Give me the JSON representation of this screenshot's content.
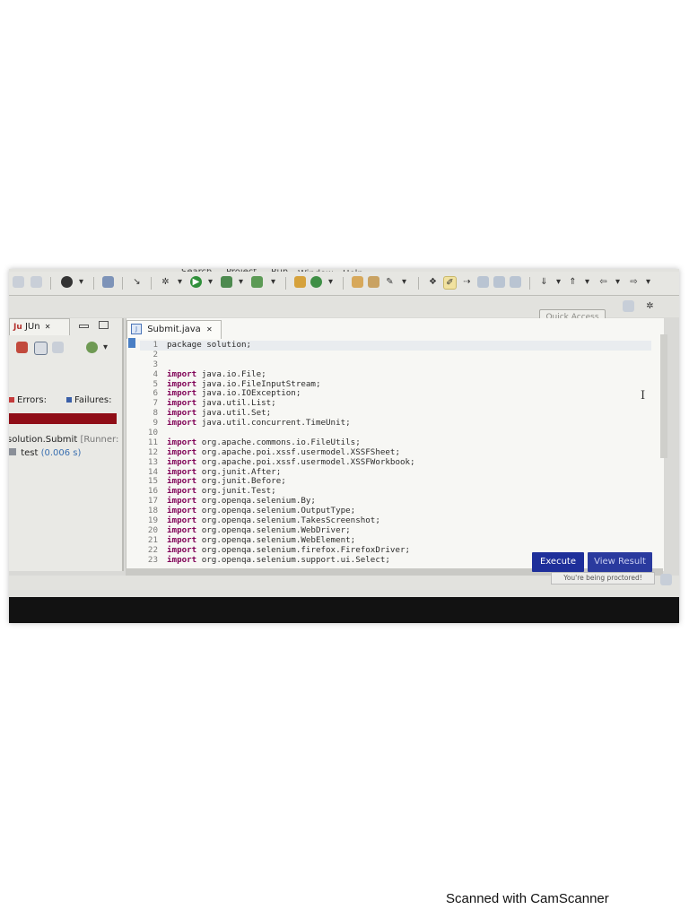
{
  "menubar": {
    "items": [
      "Search",
      "Project",
      "Run",
      "Window",
      "Help"
    ]
  },
  "quick_access": "Quick Access",
  "junit_panel": {
    "tab_label": "JUn",
    "errors_label": "Errors:",
    "failures_label": "Failures:",
    "suite": {
      "name": "solution.Submit",
      "runner": "[Runner:"
    },
    "test": {
      "name": "test",
      "time": "(0.006 s)"
    },
    "colors": {
      "failure_bar": "#8f0d16"
    }
  },
  "editor": {
    "tab_label": "Submit.java",
    "lines": [
      {
        "n": "1",
        "kw": "",
        "text": "package solution;"
      },
      {
        "n": "2",
        "kw": "",
        "text": ""
      },
      {
        "n": "3",
        "kw": "",
        "text": ""
      },
      {
        "n": "4",
        "kw": "import",
        "text": " java.io.File;"
      },
      {
        "n": "5",
        "kw": "import",
        "text": " java.io.FileInputStream;"
      },
      {
        "n": "6",
        "kw": "import",
        "text": " java.io.IOException;"
      },
      {
        "n": "7",
        "kw": "import",
        "text": " java.util.List;"
      },
      {
        "n": "8",
        "kw": "import",
        "text": " java.util.Set;"
      },
      {
        "n": "9",
        "kw": "import",
        "text": " java.util.concurrent.TimeUnit;"
      },
      {
        "n": "10",
        "kw": "",
        "text": ""
      },
      {
        "n": "11",
        "kw": "import",
        "text": " org.apache.commons.io.FileUtils;"
      },
      {
        "n": "12",
        "kw": "import",
        "text": " org.apache.poi.xssf.usermodel.XSSFSheet;"
      },
      {
        "n": "13",
        "kw": "import",
        "text": " org.apache.poi.xssf.usermodel.XSSFWorkbook;"
      },
      {
        "n": "14",
        "kw": "import",
        "text": " org.junit.After;"
      },
      {
        "n": "15",
        "kw": "import",
        "text": " org.junit.Before;"
      },
      {
        "n": "16",
        "kw": "import",
        "text": " org.junit.Test;"
      },
      {
        "n": "17",
        "kw": "import",
        "text": " org.openqa.selenium.By;"
      },
      {
        "n": "18",
        "kw": "import",
        "text": " org.openqa.selenium.OutputType;"
      },
      {
        "n": "19",
        "kw": "import",
        "text": " org.openqa.selenium.TakesScreenshot;"
      },
      {
        "n": "20",
        "kw": "import",
        "text": " org.openqa.selenium.WebDriver;"
      },
      {
        "n": "21",
        "kw": "import",
        "text": " org.openqa.selenium.WebElement;"
      },
      {
        "n": "22",
        "kw": "import",
        "text": " org.openqa.selenium.firefox.FirefoxDriver;"
      },
      {
        "n": "23",
        "kw": "import",
        "text": " org.openqa.selenium.support.ui.Select;"
      }
    ]
  },
  "actions": {
    "execute": "Execute",
    "view_result": "View Result",
    "proctored_notice": "You're being proctored!",
    "colors": {
      "execute_bg": "#1e2f9a"
    }
  },
  "footer": "Scanned with CamScanner"
}
